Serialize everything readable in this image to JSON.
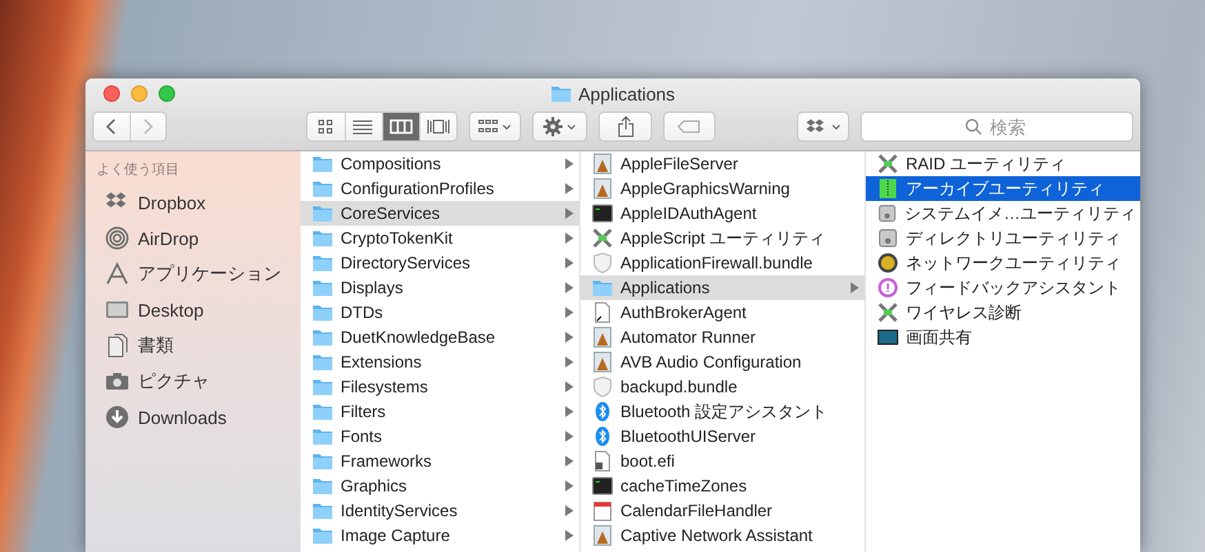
{
  "window": {
    "title": "Applications"
  },
  "toolbar": {
    "view_modes": [
      {
        "kind": "icons",
        "selected": false
      },
      {
        "kind": "list",
        "selected": false
      },
      {
        "kind": "columns",
        "selected": true
      },
      {
        "kind": "coverflow",
        "selected": false
      }
    ],
    "search": {
      "placeholder": "検索"
    }
  },
  "sidebar": {
    "heading": "よく使う項目",
    "items": [
      {
        "kind": "dropbox",
        "label": "Dropbox"
      },
      {
        "kind": "airdrop",
        "label": "AirDrop"
      },
      {
        "kind": "applications",
        "label": "アプリケーション"
      },
      {
        "kind": "desktop",
        "label": "Desktop"
      },
      {
        "kind": "documents",
        "label": "書類"
      },
      {
        "kind": "pictures",
        "label": "ピクチャ"
      },
      {
        "kind": "downloads",
        "label": "Downloads"
      }
    ]
  },
  "columns": [
    {
      "focused": false,
      "items": [
        {
          "kind": "folder",
          "name": "Compositions",
          "expandable": true,
          "selected": false
        },
        {
          "kind": "folder",
          "name": "ConfigurationProfiles",
          "expandable": true,
          "selected": false
        },
        {
          "kind": "folder",
          "name": "CoreServices",
          "expandable": true,
          "selected": true
        },
        {
          "kind": "folder",
          "name": "CryptoTokenKit",
          "expandable": true,
          "selected": false
        },
        {
          "kind": "folder",
          "name": "DirectoryServices",
          "expandable": true,
          "selected": false
        },
        {
          "kind": "folder",
          "name": "Displays",
          "expandable": true,
          "selected": false
        },
        {
          "kind": "folder",
          "name": "DTDs",
          "expandable": true,
          "selected": false
        },
        {
          "kind": "folder",
          "name": "DuetKnowledgeBase",
          "expandable": true,
          "selected": false
        },
        {
          "kind": "folder",
          "name": "Extensions",
          "expandable": true,
          "selected": false
        },
        {
          "kind": "folder",
          "name": "Filesystems",
          "expandable": true,
          "selected": false
        },
        {
          "kind": "folder",
          "name": "Filters",
          "expandable": true,
          "selected": false
        },
        {
          "kind": "folder",
          "name": "Fonts",
          "expandable": true,
          "selected": false
        },
        {
          "kind": "folder",
          "name": "Frameworks",
          "expandable": true,
          "selected": false
        },
        {
          "kind": "folder",
          "name": "Graphics",
          "expandable": true,
          "selected": false
        },
        {
          "kind": "folder",
          "name": "IdentityServices",
          "expandable": true,
          "selected": false
        },
        {
          "kind": "folder",
          "name": "Image Capture",
          "expandable": true,
          "selected": false
        }
      ]
    },
    {
      "focused": false,
      "items": [
        {
          "kind": "app",
          "name": "AppleFileServer",
          "expandable": false,
          "selected": false
        },
        {
          "kind": "app",
          "name": "AppleGraphicsWarning",
          "expandable": false,
          "selected": false
        },
        {
          "kind": "terminal",
          "name": "AppleIDAuthAgent",
          "expandable": false,
          "selected": false
        },
        {
          "kind": "tools",
          "name": "AppleScript ユーティリティ",
          "expandable": false,
          "selected": false
        },
        {
          "kind": "bundle",
          "name": "ApplicationFirewall.bundle",
          "expandable": false,
          "selected": false
        },
        {
          "kind": "folder",
          "name": "Applications",
          "expandable": true,
          "selected": true
        },
        {
          "kind": "alias",
          "name": "AuthBrokerAgent",
          "expandable": false,
          "selected": false
        },
        {
          "kind": "app",
          "name": "Automator Runner",
          "expandable": false,
          "selected": false
        },
        {
          "kind": "app",
          "name": "AVB Audio Configuration",
          "expandable": false,
          "selected": false
        },
        {
          "kind": "bundle",
          "name": "backupd.bundle",
          "expandable": false,
          "selected": false
        },
        {
          "kind": "bluetooth",
          "name": "Bluetooth 設定アシスタント",
          "expandable": false,
          "selected": false
        },
        {
          "kind": "bluetooth",
          "name": "BluetoothUIServer",
          "expandable": false,
          "selected": false
        },
        {
          "kind": "locked",
          "name": "boot.efi",
          "expandable": false,
          "selected": false
        },
        {
          "kind": "terminal",
          "name": "cacheTimeZones",
          "expandable": false,
          "selected": false
        },
        {
          "kind": "calendar",
          "name": "CalendarFileHandler",
          "expandable": false,
          "selected": false
        },
        {
          "kind": "app",
          "name": "Captive Network Assistant",
          "expandable": false,
          "selected": false
        }
      ]
    },
    {
      "focused": true,
      "items": [
        {
          "kind": "tools",
          "name": "RAID ユーティリティ",
          "expandable": false,
          "selected": false
        },
        {
          "kind": "archive",
          "name": "アーカイブユーティリティ",
          "expandable": false,
          "selected": true
        },
        {
          "kind": "disk",
          "name": "システムイメ…ユーティリティ",
          "expandable": false,
          "selected": false
        },
        {
          "kind": "disk",
          "name": "ディレクトリユーティリティ",
          "expandable": false,
          "selected": false
        },
        {
          "kind": "network",
          "name": "ネットワークユーティリティ",
          "expandable": false,
          "selected": false
        },
        {
          "kind": "feedback",
          "name": "フィードバックアシスタント",
          "expandable": false,
          "selected": false
        },
        {
          "kind": "tools",
          "name": "ワイヤレス診断",
          "expandable": false,
          "selected": false
        },
        {
          "kind": "screen",
          "name": "画面共有",
          "expandable": false,
          "selected": false
        }
      ]
    }
  ]
}
